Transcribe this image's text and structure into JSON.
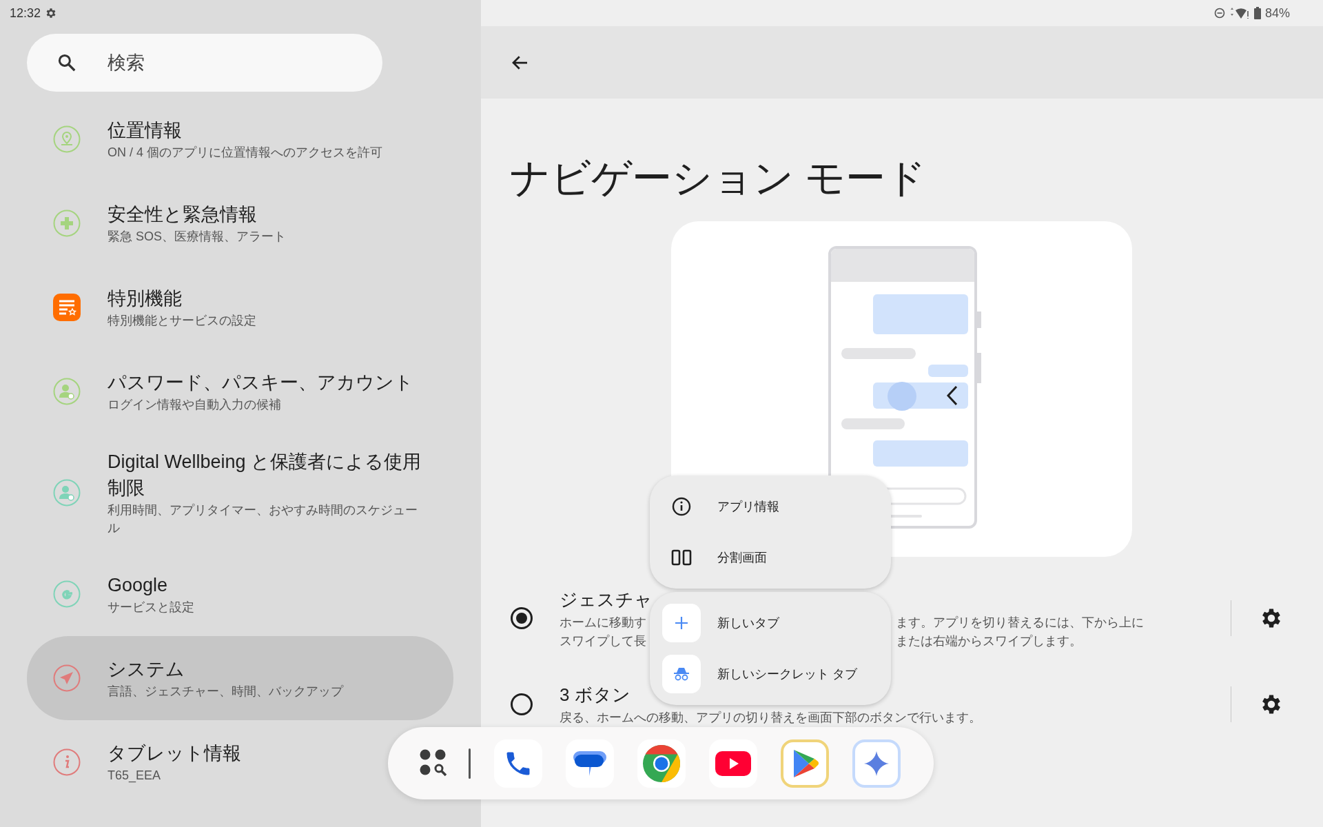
{
  "status_bar": {
    "time": "12:32",
    "battery": "84%"
  },
  "search": {
    "placeholder": "検索"
  },
  "sidebar": {
    "items": [
      {
        "kind": "location",
        "title": "位置情報",
        "subtitle": "ON / 4 個のアプリに位置情報へのアクセスを許可",
        "color": "#a5d47f",
        "selected": false
      },
      {
        "kind": "safety",
        "title": "安全性と緊急情報",
        "subtitle": "緊急 SOS、医療情報、アラート",
        "color": "#a5d47f",
        "selected": false
      },
      {
        "kind": "accessibility",
        "title": "特別機能",
        "subtitle": "特別機能とサービスの設定",
        "color": "#ff6d00",
        "selected": false
      },
      {
        "kind": "account",
        "title": "パスワード、パスキー、アカウント",
        "subtitle": "ログイン情報や自動入力の候補",
        "color": "#a5d47f",
        "selected": false
      },
      {
        "kind": "wellbeing",
        "title": "Digital Wellbeing と保護者による使用制限",
        "subtitle": "利用時間、アプリタイマー、おやすみ時間のスケジュール",
        "color": "#7fd4b8",
        "selected": false
      },
      {
        "kind": "google",
        "title": "Google",
        "subtitle": "サービスと設定",
        "color": "#7fd4b8",
        "selected": false
      },
      {
        "kind": "system",
        "title": "システム",
        "subtitle": "言語、ジェスチャー、時間、バックアップ",
        "color": "#e07b7b",
        "selected": true
      },
      {
        "kind": "info",
        "title": "タブレット情報",
        "subtitle": "T65_EEA",
        "color": "#e07b7b",
        "selected": false
      }
    ]
  },
  "page": {
    "title": "ナビゲーション モード",
    "options": [
      {
        "title": "ジェスチャ",
        "selected": true,
        "lines": [
          {
            "left": "ホームに移動す",
            "right": "ます。アプリを切り替えるには、下から上に"
          },
          {
            "left": "スワイプして長",
            "right": "または右端からスワイプします。"
          }
        ]
      },
      {
        "title": "3 ボタン",
        "selected": false,
        "lines": [
          {
            "left": "戻る、ホームへの移動、アプリの切り替えを画面下部のボタンで行います。"
          }
        ]
      }
    ]
  },
  "popup": {
    "groups": [
      [
        {
          "kind": "info",
          "label": "アプリ情報"
        },
        {
          "kind": "split",
          "label": "分割画面"
        }
      ],
      [
        {
          "kind": "new-tab",
          "label": "新しいタブ"
        },
        {
          "kind": "incognito",
          "label": "新しいシークレット タブ"
        }
      ]
    ]
  }
}
